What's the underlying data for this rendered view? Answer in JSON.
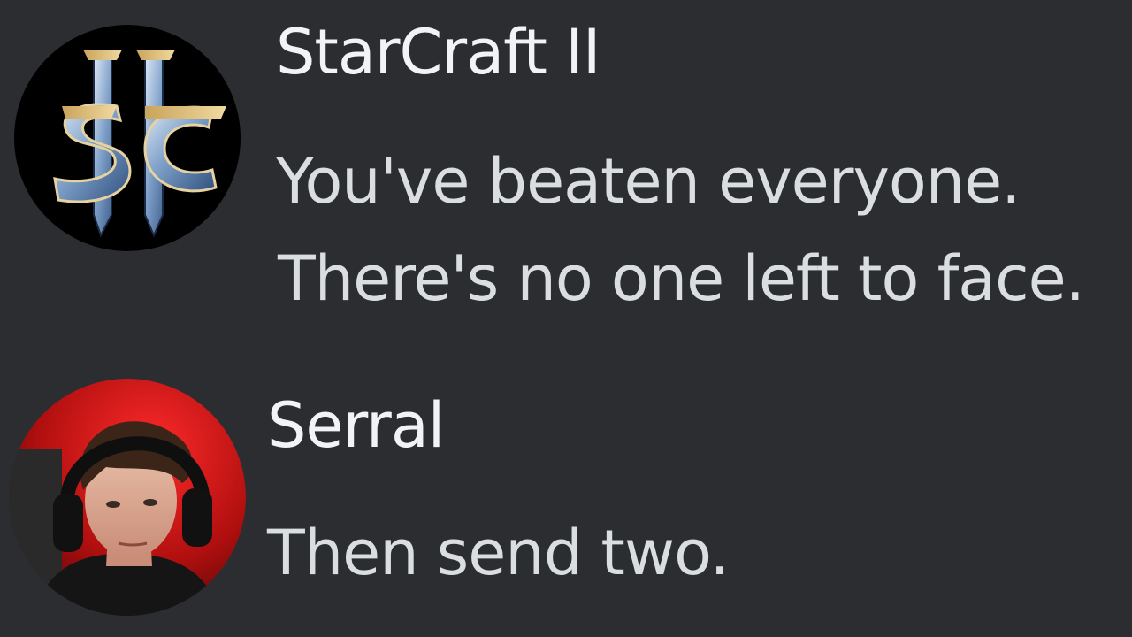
{
  "messages": [
    {
      "username": "StarCraft II",
      "avatar_icon": "starcraft-logo-icon",
      "lines": [
        "You've beaten everyone.",
        "There's no one left to face."
      ]
    },
    {
      "username": "Serral",
      "avatar_icon": "user-photo-avatar",
      "lines": [
        "Then send two."
      ]
    }
  ],
  "colors": {
    "background": "#2b2d31",
    "username": "#f2f3f5",
    "message_text": "#dbdee1"
  }
}
